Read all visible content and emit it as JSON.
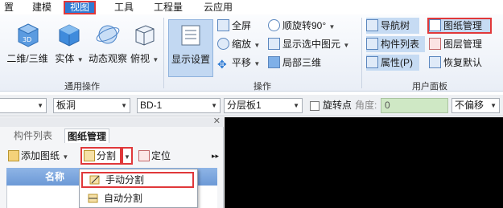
{
  "menubar": {
    "items": [
      "置",
      "建模",
      "视图",
      "工具",
      "工程量",
      "云应用"
    ],
    "active": "视图"
  },
  "ribbon": {
    "general": {
      "group_label": "通用操作",
      "buttons": [
        "二维/三维",
        "实体",
        "动态观察",
        "俯视"
      ]
    },
    "ops": {
      "group_label": "操作",
      "display_settings": "显示设置",
      "fullscreen": "全屏",
      "zoom": "缩放",
      "pan": "平移",
      "rotate_cw": "顺旋转90°",
      "show_selected": "显示选中图元",
      "local_3d": "局部三维"
    },
    "user_panel": {
      "group_label": "用户面板",
      "nav_tree": "导航树",
      "drawing_mgmt": "图纸管理",
      "component_list": "构件列表",
      "layer_mgmt": "图层管理",
      "properties": "属性(P)",
      "restore_default": "恢复默认"
    }
  },
  "propbar": {
    "combo1": "",
    "combo2": "板洞",
    "combo3": "BD-1",
    "combo4": "分层板1",
    "rotate_point": "旋转点",
    "angle_label": "角度:",
    "angle_value": "0",
    "offset": "不偏移"
  },
  "panel": {
    "tabs": [
      "构件列表",
      "图纸管理"
    ],
    "active_tab": "图纸管理",
    "add_drawing": "添加图纸",
    "split": "分割",
    "locate": "定位",
    "column_name": "名称",
    "split_menu": [
      "手动分割",
      "自动分割"
    ]
  },
  "colors": {
    "accent": "#2e7bd4",
    "highlight_box": "#e0383a",
    "grid_header": "#7ea7de",
    "angle_field": "#cfe8c5"
  }
}
